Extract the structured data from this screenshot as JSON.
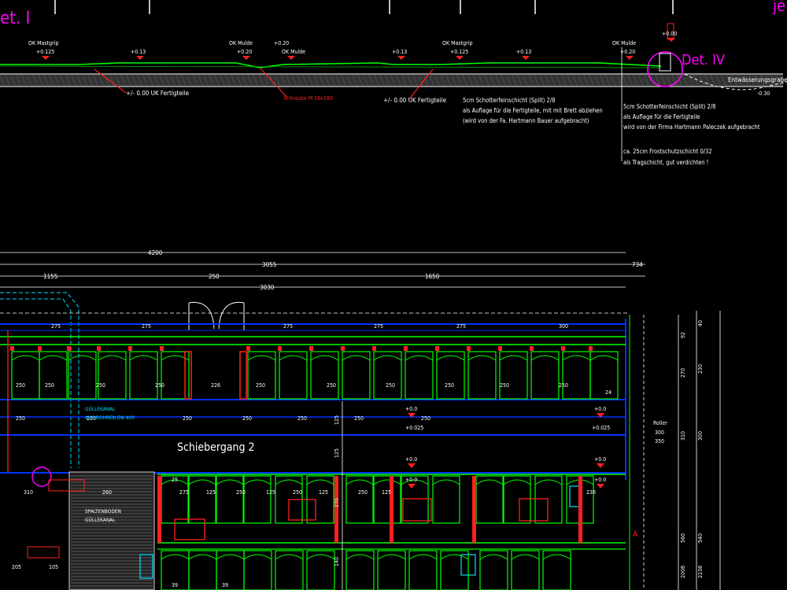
{
  "drawing": {
    "detail_left": "et. I",
    "detail_right": "je",
    "detail_iv": "Det. IV",
    "section": {
      "levels": [
        {
          "name": "OK Mastgrip",
          "value": "+0.125"
        },
        {
          "name": "",
          "value": "+0.13"
        },
        {
          "name": "OK Mulde",
          "value": "+0.20"
        },
        {
          "name": "+0.20",
          "value": "OK Mulde"
        },
        {
          "name": "",
          "value": "+0.13"
        },
        {
          "name": "OK Mastgrip",
          "value": "+0.125"
        },
        {
          "name": "",
          "value": "+0.13"
        },
        {
          "name": "OK Mulde",
          "value": "+0.20"
        },
        {
          "name": "",
          "value": "+0.00"
        }
      ],
      "uk_left": "+/- 0.00 UK Fertigteile",
      "uk_right": "+/- 0.00 UK Fertigteile",
      "screw": "Schraube M 16x180",
      "note1": [
        "5cm Schotterfeinschicht (Split) 2/8",
        "als Auflage für die Fertigteile, mit mit Brett abziehen",
        "(wird von der Fa. Hartmann Bauer aufgebracht)"
      ],
      "note2": [
        "5cm Schotterfeinschicht (Split) 2/8",
        "als Auflage für die Fertigteile",
        "wird von der Firma Hartmann Paleczek aufgebracht"
      ],
      "note3": [
        "ca. 25cm Frostschutzschicht 0/32",
        "als Tragschicht, gut verdichten !"
      ],
      "edge_label": "Entwässerungsgraben",
      "edge_level": "-0.30"
    },
    "dimensions": {
      "total": "4200",
      "part_right": "3055",
      "right_small": "734",
      "left": "1155",
      "mid": "250",
      "right": "1650",
      "bottom_total": "3030"
    },
    "plan": {
      "gang_label": "Schiebergang 2",
      "gully_canal": [
        "GÜLLEKANAL",
        "AUS ROHREN DN 400"
      ],
      "slatted_floor": [
        "SPALTENBODEN",
        "GÜLLEKANAL"
      ],
      "top_row_dims": [
        "275",
        "275",
        "275",
        "275",
        "275",
        "300"
      ],
      "box_dims": [
        "250",
        "250",
        "250",
        "250",
        "226",
        "250",
        "250",
        "250",
        "250",
        "250",
        "250",
        "250"
      ],
      "gang_dims": [
        "250",
        "250",
        "250",
        "250",
        "250",
        "250",
        "250"
      ],
      "lower_dims": [
        "275",
        "125",
        "250",
        "125",
        "250",
        "125",
        "250",
        "125"
      ],
      "level_marks": [
        "+0.0",
        "+0.0",
        "+0.0",
        "+0.0",
        "+0.0",
        "+0.0"
      ],
      "level_025": "+0.025",
      "small_labels": [
        "24",
        "25",
        "236",
        "310",
        "260",
        "205",
        "105",
        "39",
        "39"
      ],
      "vert_dims": [
        "125",
        "125",
        "270",
        "140"
      ],
      "right_col": [
        "92",
        "270",
        "310",
        "560",
        "2008"
      ],
      "right_col2": [
        "40",
        "230",
        "300",
        "540",
        "2238"
      ],
      "roller": [
        "Roller",
        "300",
        "350"
      ],
      "marker_a": "A"
    }
  },
  "colors": {
    "bg": "#000000",
    "green": "#00ff00",
    "blue": "#0033ff",
    "red": "#ff2020",
    "magenta": "#ff00ff",
    "cyan": "#00e0ff",
    "white": "#ffffff"
  }
}
